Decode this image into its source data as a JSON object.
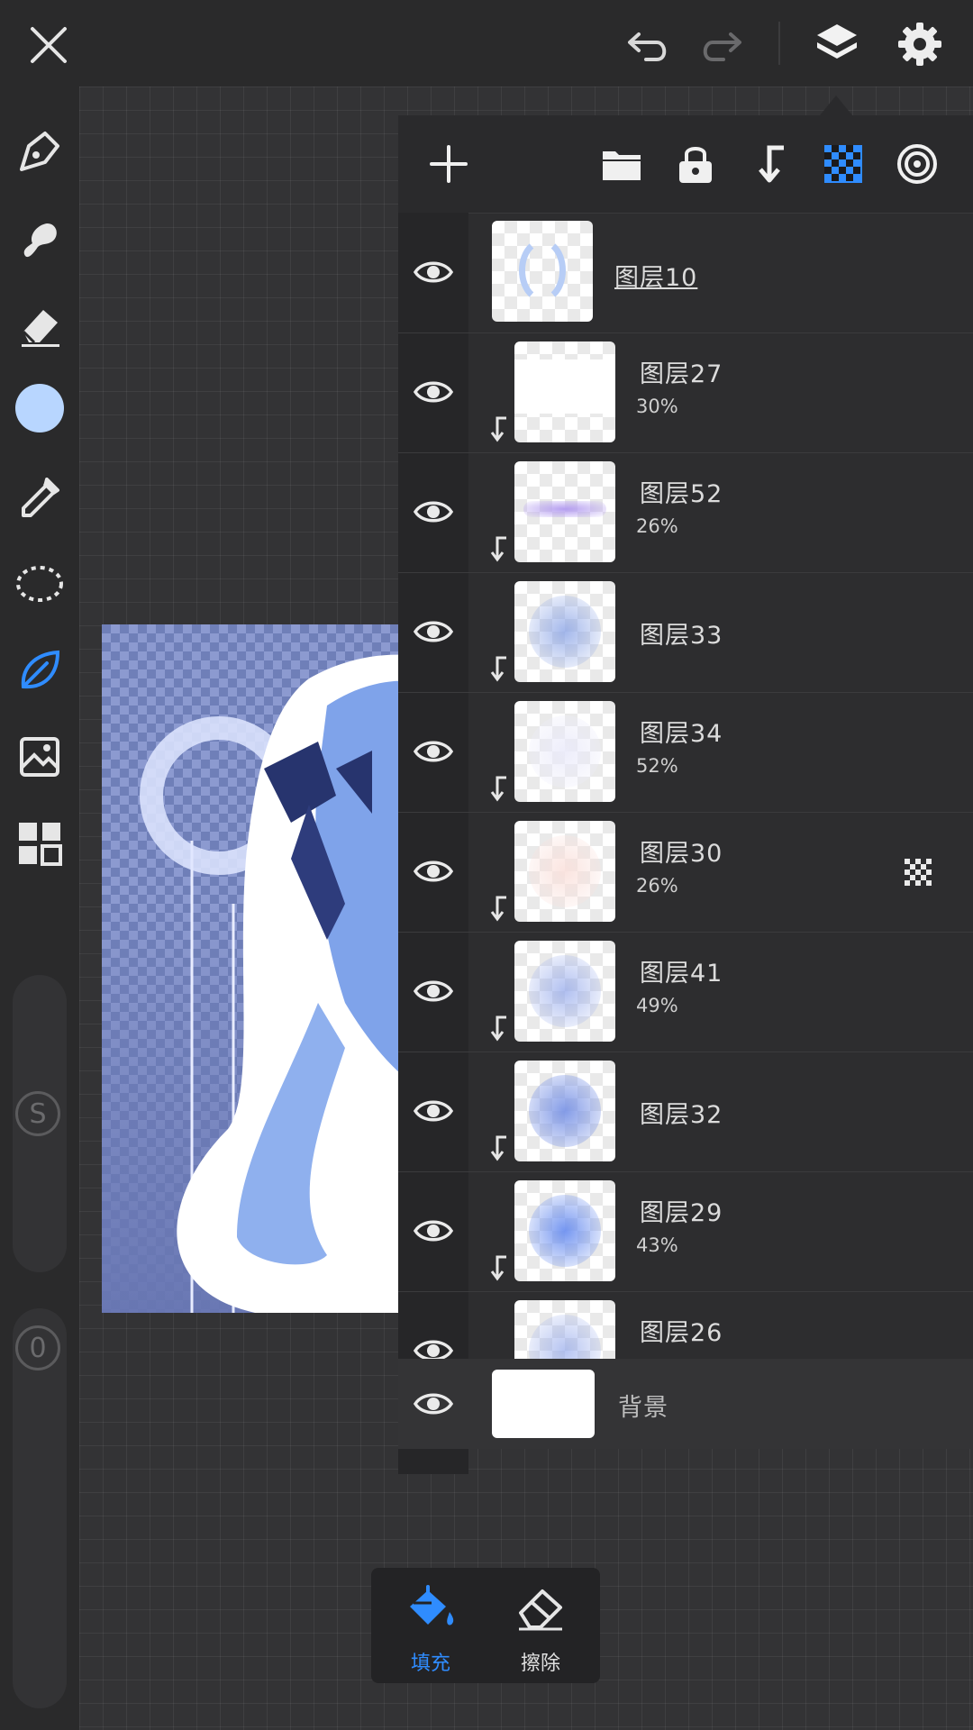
{
  "colors": {
    "accent": "#2f8cff",
    "brush_color": "#b8d6ff",
    "panel_bg": "#2d2d2f",
    "icon": "#e6e6e6"
  },
  "topbar": {
    "icons": [
      "close-icon",
      "undo-icon",
      "redo-icon",
      "layers-icon",
      "settings-icon"
    ]
  },
  "left_toolbar": {
    "tools": [
      "pen-tool-icon",
      "smudge-tool-icon",
      "eraser-tool-icon",
      "color-swatch",
      "eyedropper-icon",
      "lasso-selection-icon",
      "leaf-tool-icon",
      "import-image-icon",
      "grid-menu-icon"
    ],
    "size_badge": "S",
    "opacity_badge": "0"
  },
  "layers_panel": {
    "toolbar": [
      "add-layer-icon",
      "folder-icon",
      "lock-icon",
      "clipping-mask-icon",
      "alpha-lock-icon",
      "blend-mode-icon"
    ],
    "layers": [
      {
        "name": "图层10",
        "opacity": "",
        "clipped": false
      },
      {
        "name": "图层27",
        "opacity": "30%",
        "clipped": true
      },
      {
        "name": "图层52",
        "opacity": "26%",
        "clipped": true
      },
      {
        "name": "图层33",
        "opacity": "",
        "clipped": true
      },
      {
        "name": "图层34",
        "opacity": "52%",
        "clipped": true
      },
      {
        "name": "图层30",
        "opacity": "26%",
        "clipped": true
      },
      {
        "name": "图层41",
        "opacity": "49%",
        "clipped": true
      },
      {
        "name": "图层32",
        "opacity": "",
        "clipped": true
      },
      {
        "name": "图层29",
        "opacity": "43%",
        "clipped": true
      },
      {
        "name": "图层26",
        "opacity": "",
        "clipped": true
      }
    ],
    "background_layer": "背景"
  },
  "bottom_tools": {
    "fill_label": "填充",
    "erase_label": "擦除"
  }
}
